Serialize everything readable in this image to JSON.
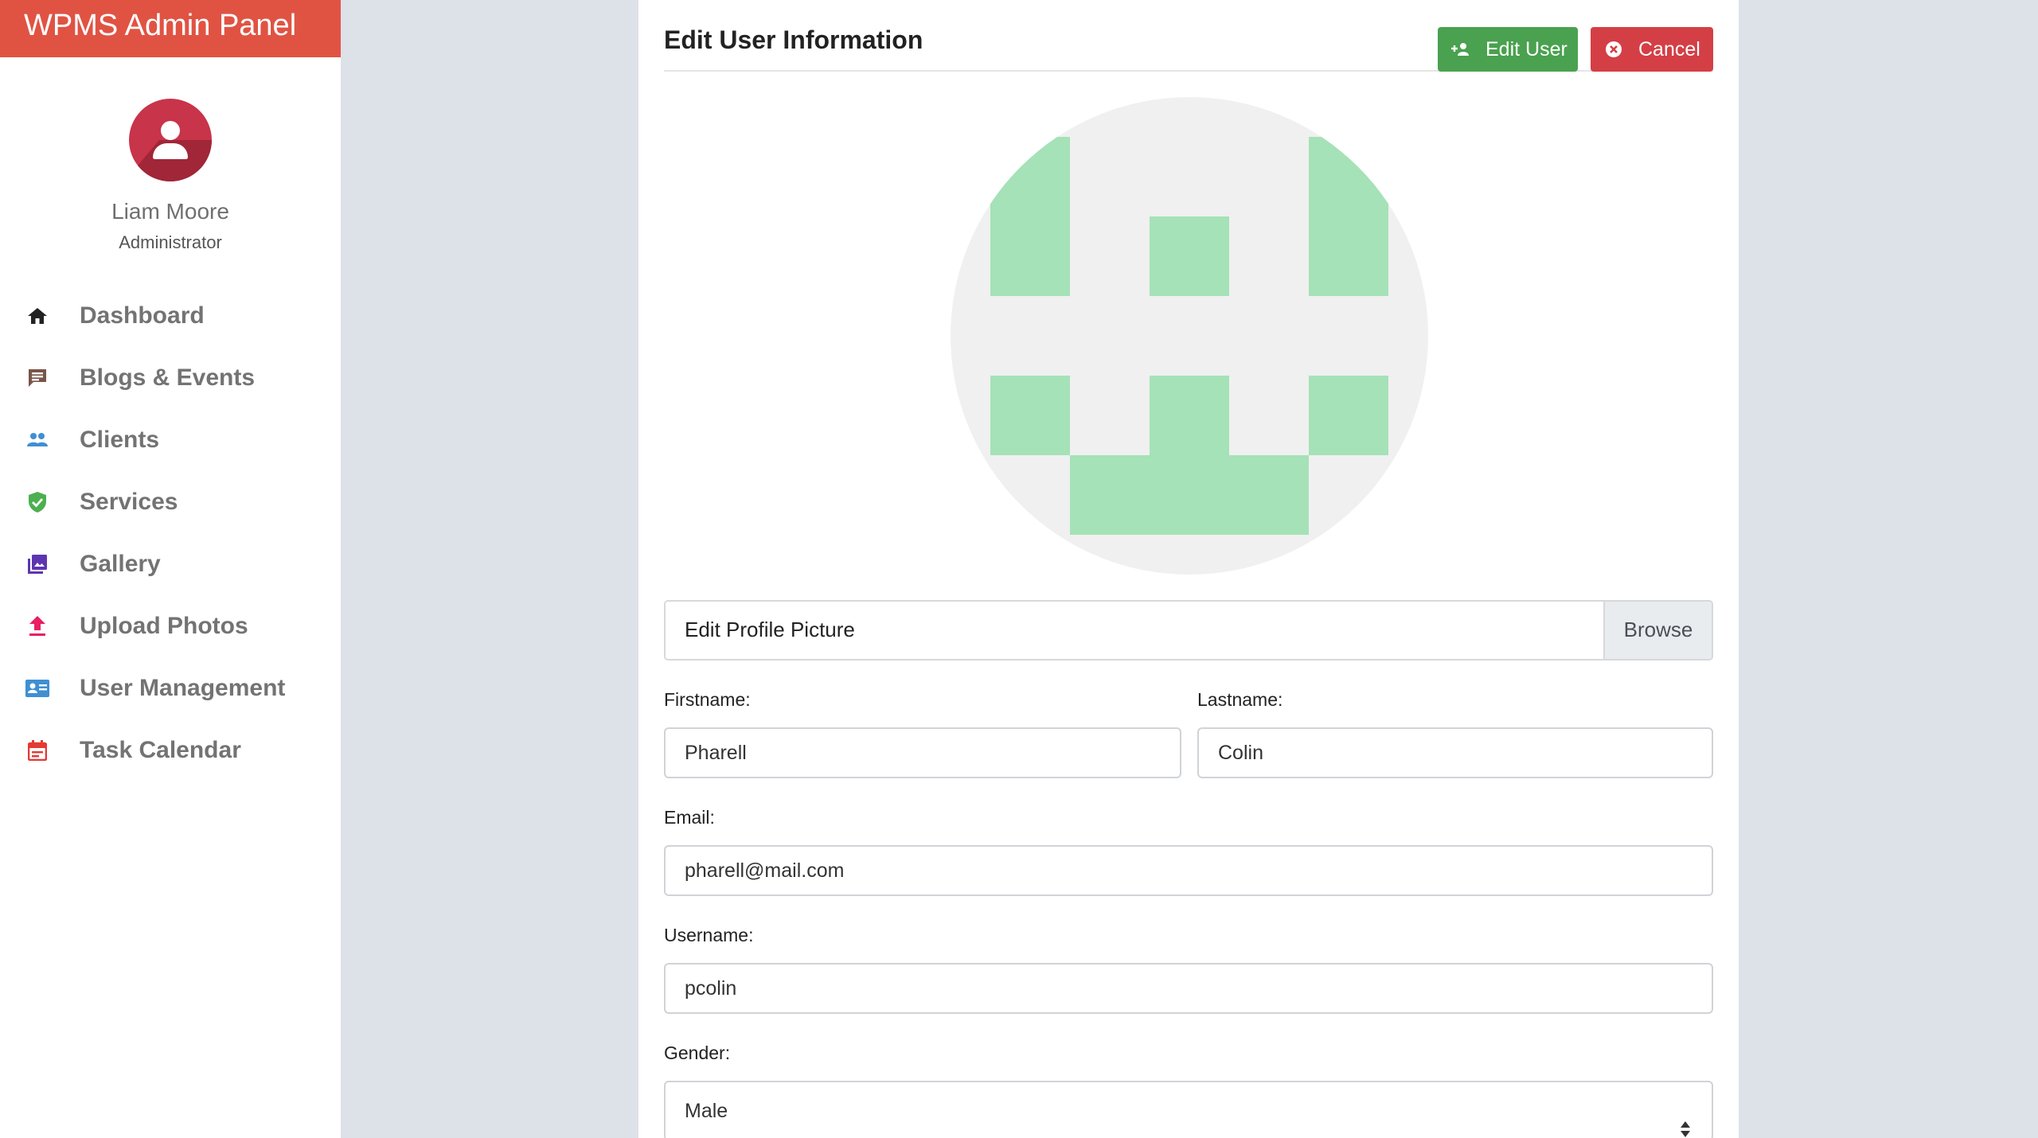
{
  "sidebar": {
    "brand": "WPMS Admin Panel",
    "user": {
      "name": "Liam Moore",
      "role": "Administrator"
    },
    "items": [
      {
        "label": "Dashboard",
        "icon": "home-icon",
        "color": "#222222"
      },
      {
        "label": "Blogs & Events",
        "icon": "comment-icon",
        "color": "#795548"
      },
      {
        "label": "Clients",
        "icon": "people-icon",
        "color": "#3f8fd2"
      },
      {
        "label": "Services",
        "icon": "shield-check-icon",
        "color": "#4caf50"
      },
      {
        "label": "Gallery",
        "icon": "photo-library-icon",
        "color": "#5e35b1"
      },
      {
        "label": "Upload Photos",
        "icon": "upload-icon",
        "color": "#e91e63"
      },
      {
        "label": "User Management",
        "icon": "id-card-icon",
        "color": "#3f8fd2"
      },
      {
        "label": "Task Calendar",
        "icon": "calendar-icon",
        "color": "#e53935"
      }
    ]
  },
  "main": {
    "title": "Edit User Information",
    "edit_button": "Edit User",
    "cancel_button": "Cancel",
    "file_input": {
      "label": "Edit Profile Picture",
      "browse": "Browse"
    },
    "fields": {
      "firstname": {
        "label": "Firstname:",
        "value": "Pharell"
      },
      "lastname": {
        "label": "Lastname:",
        "value": "Colin"
      },
      "email": {
        "label": "Email:",
        "value": "pharell@mail.com"
      },
      "username": {
        "label": "Username:",
        "value": "pcolin"
      },
      "gender": {
        "label": "Gender:",
        "value": "Male"
      }
    }
  },
  "colors": {
    "brand": "#e05343",
    "edit_button": "#4aa14f",
    "cancel_button": "#d33f45",
    "identicon_fill": "#a5e2b7",
    "identicon_bg": "#f0f0f0"
  }
}
